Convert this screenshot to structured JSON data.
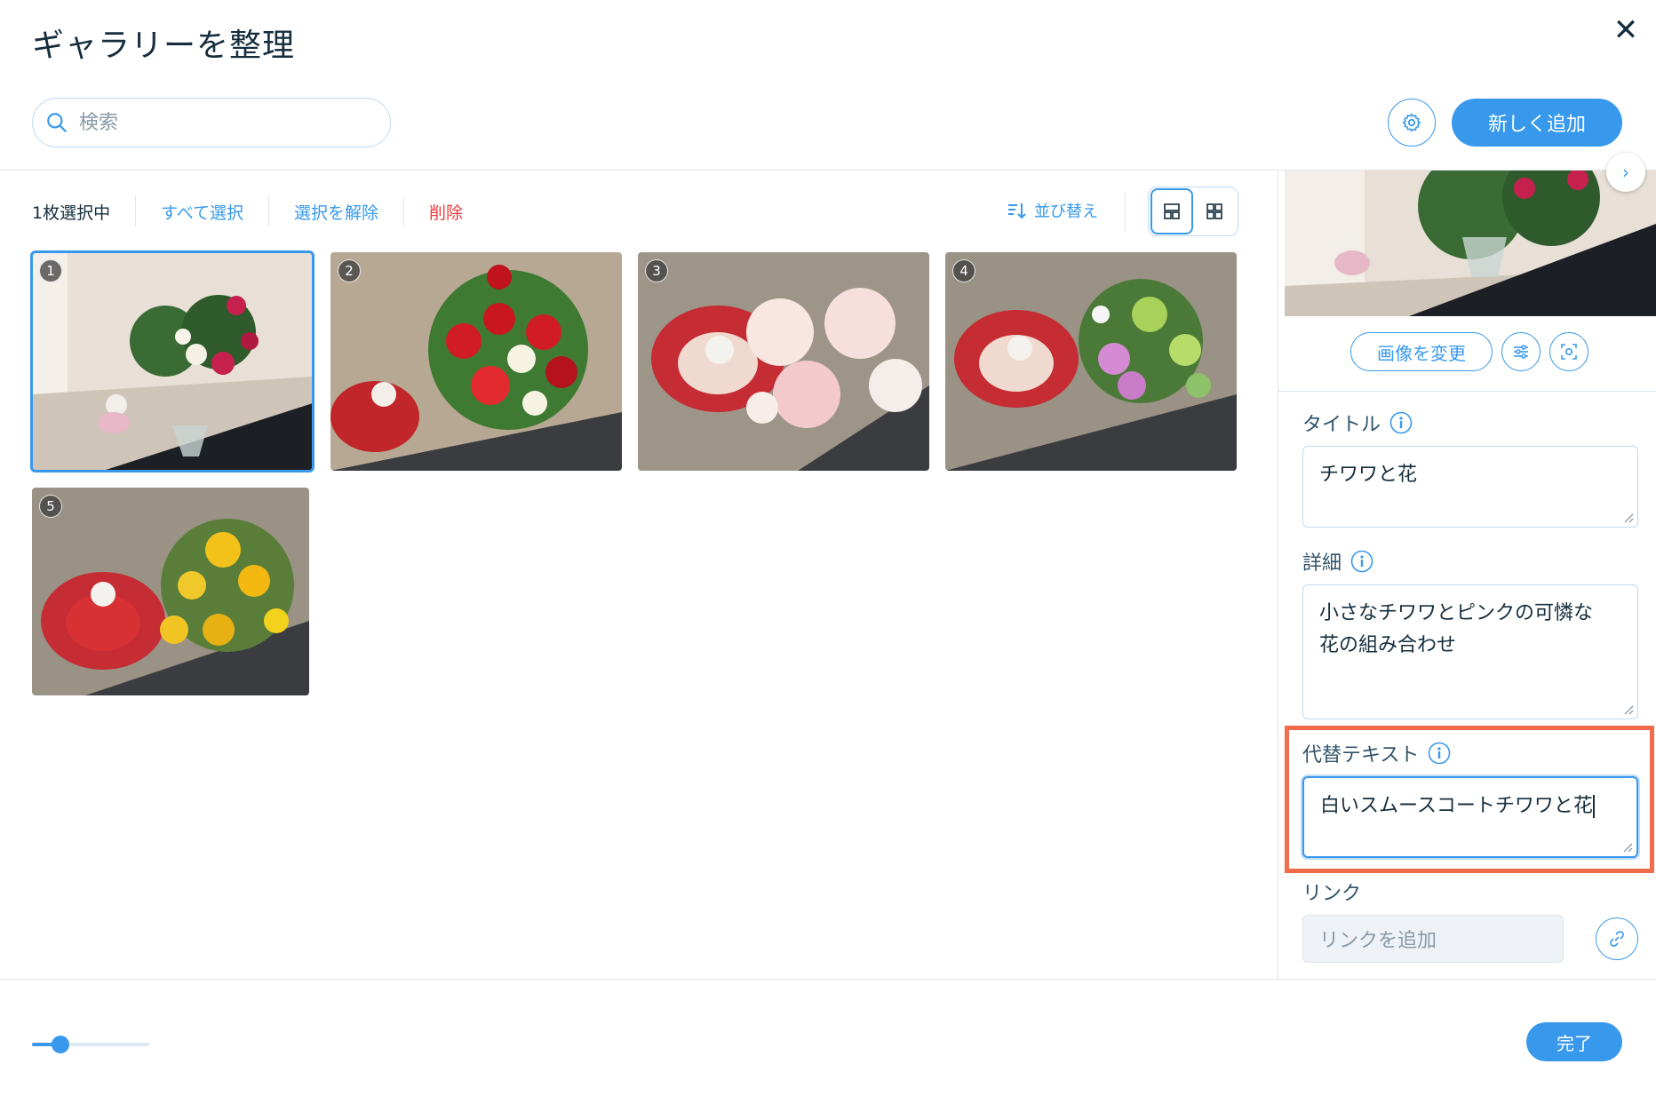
{
  "header": {
    "title": "ギャラリーを整理",
    "search_placeholder": "検索",
    "add_button": "新しく追加"
  },
  "toolbar": {
    "selected_count": "1枚選択中",
    "select_all": "すべて選択",
    "deselect": "選択を解除",
    "delete": "削除",
    "sort": "並び替え"
  },
  "gallery": {
    "items": [
      {
        "number": "1",
        "selected": true
      },
      {
        "number": "2",
        "selected": false
      },
      {
        "number": "3",
        "selected": false
      },
      {
        "number": "4",
        "selected": false
      },
      {
        "number": "5",
        "selected": false
      }
    ]
  },
  "panel": {
    "change_image": "画像を変更",
    "title_label": "タイトル",
    "title_value": "チワワと花",
    "description_label": "詳細",
    "description_line1": "小さなチワワとピンクの可憐な",
    "description_line2": "花の組み合わせ",
    "alt_label": "代替テキスト",
    "alt_value": "白いスムースコートチワワと花",
    "link_label": "リンク",
    "link_placeholder": "リンクを追加"
  },
  "footer": {
    "done": "完了",
    "zoom_level": 0.2
  },
  "colors": {
    "accent": "#3899ec",
    "danger": "#ee3b3b",
    "highlight": "#f26b4b"
  },
  "icons": [
    "close-icon",
    "search-icon",
    "gear-icon",
    "sort-icon",
    "layout-masonry-icon",
    "layout-grid-icon",
    "chevron-right-icon",
    "adjust-icon",
    "focal-point-icon",
    "info-icon",
    "link-icon"
  ]
}
